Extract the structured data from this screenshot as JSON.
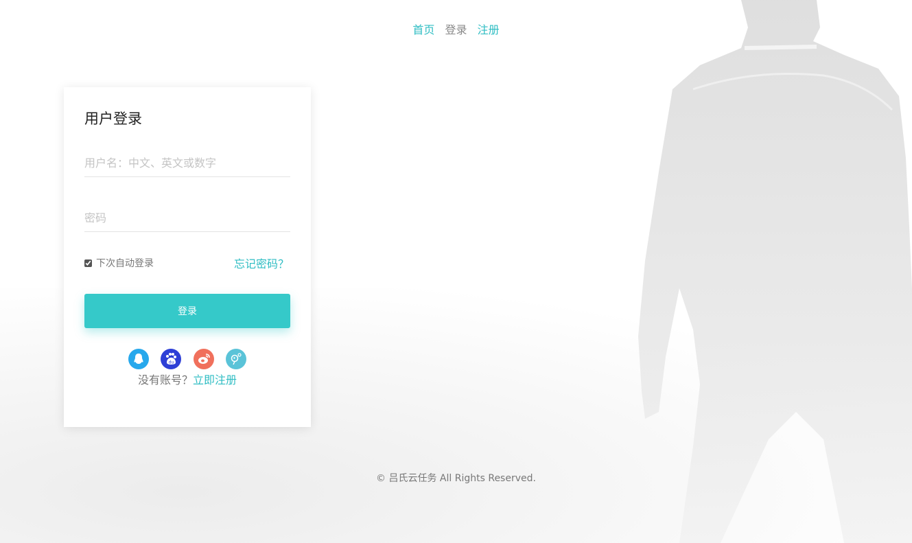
{
  "nav": {
    "home": "首页",
    "login": "登录",
    "register": "注册"
  },
  "login_card": {
    "title": "用户登录",
    "username_placeholder": "用户名：中文、英文或数字",
    "username_value": "",
    "password_placeholder": "密码",
    "password_value": "",
    "remember_label": "下次自动登录",
    "remember_checked": true,
    "forgot_label": "忘记密码？",
    "submit_label": "登录",
    "social_logins": [
      {
        "name": "qq-icon",
        "color": "#27a8ec"
      },
      {
        "name": "baidu-icon",
        "color": "#2d3fd6"
      },
      {
        "name": "weibo-icon",
        "color": "#f0705c"
      },
      {
        "name": "other-login-icon",
        "color": "#5ac3d8"
      }
    ],
    "no_account_text": "没有账号？",
    "register_now": "立即注册"
  },
  "footer": {
    "copyright": "© 吕氏云任务 All Rights Reserved."
  },
  "colors": {
    "accent": "#35c9c9",
    "link": "#2fbdc3"
  }
}
